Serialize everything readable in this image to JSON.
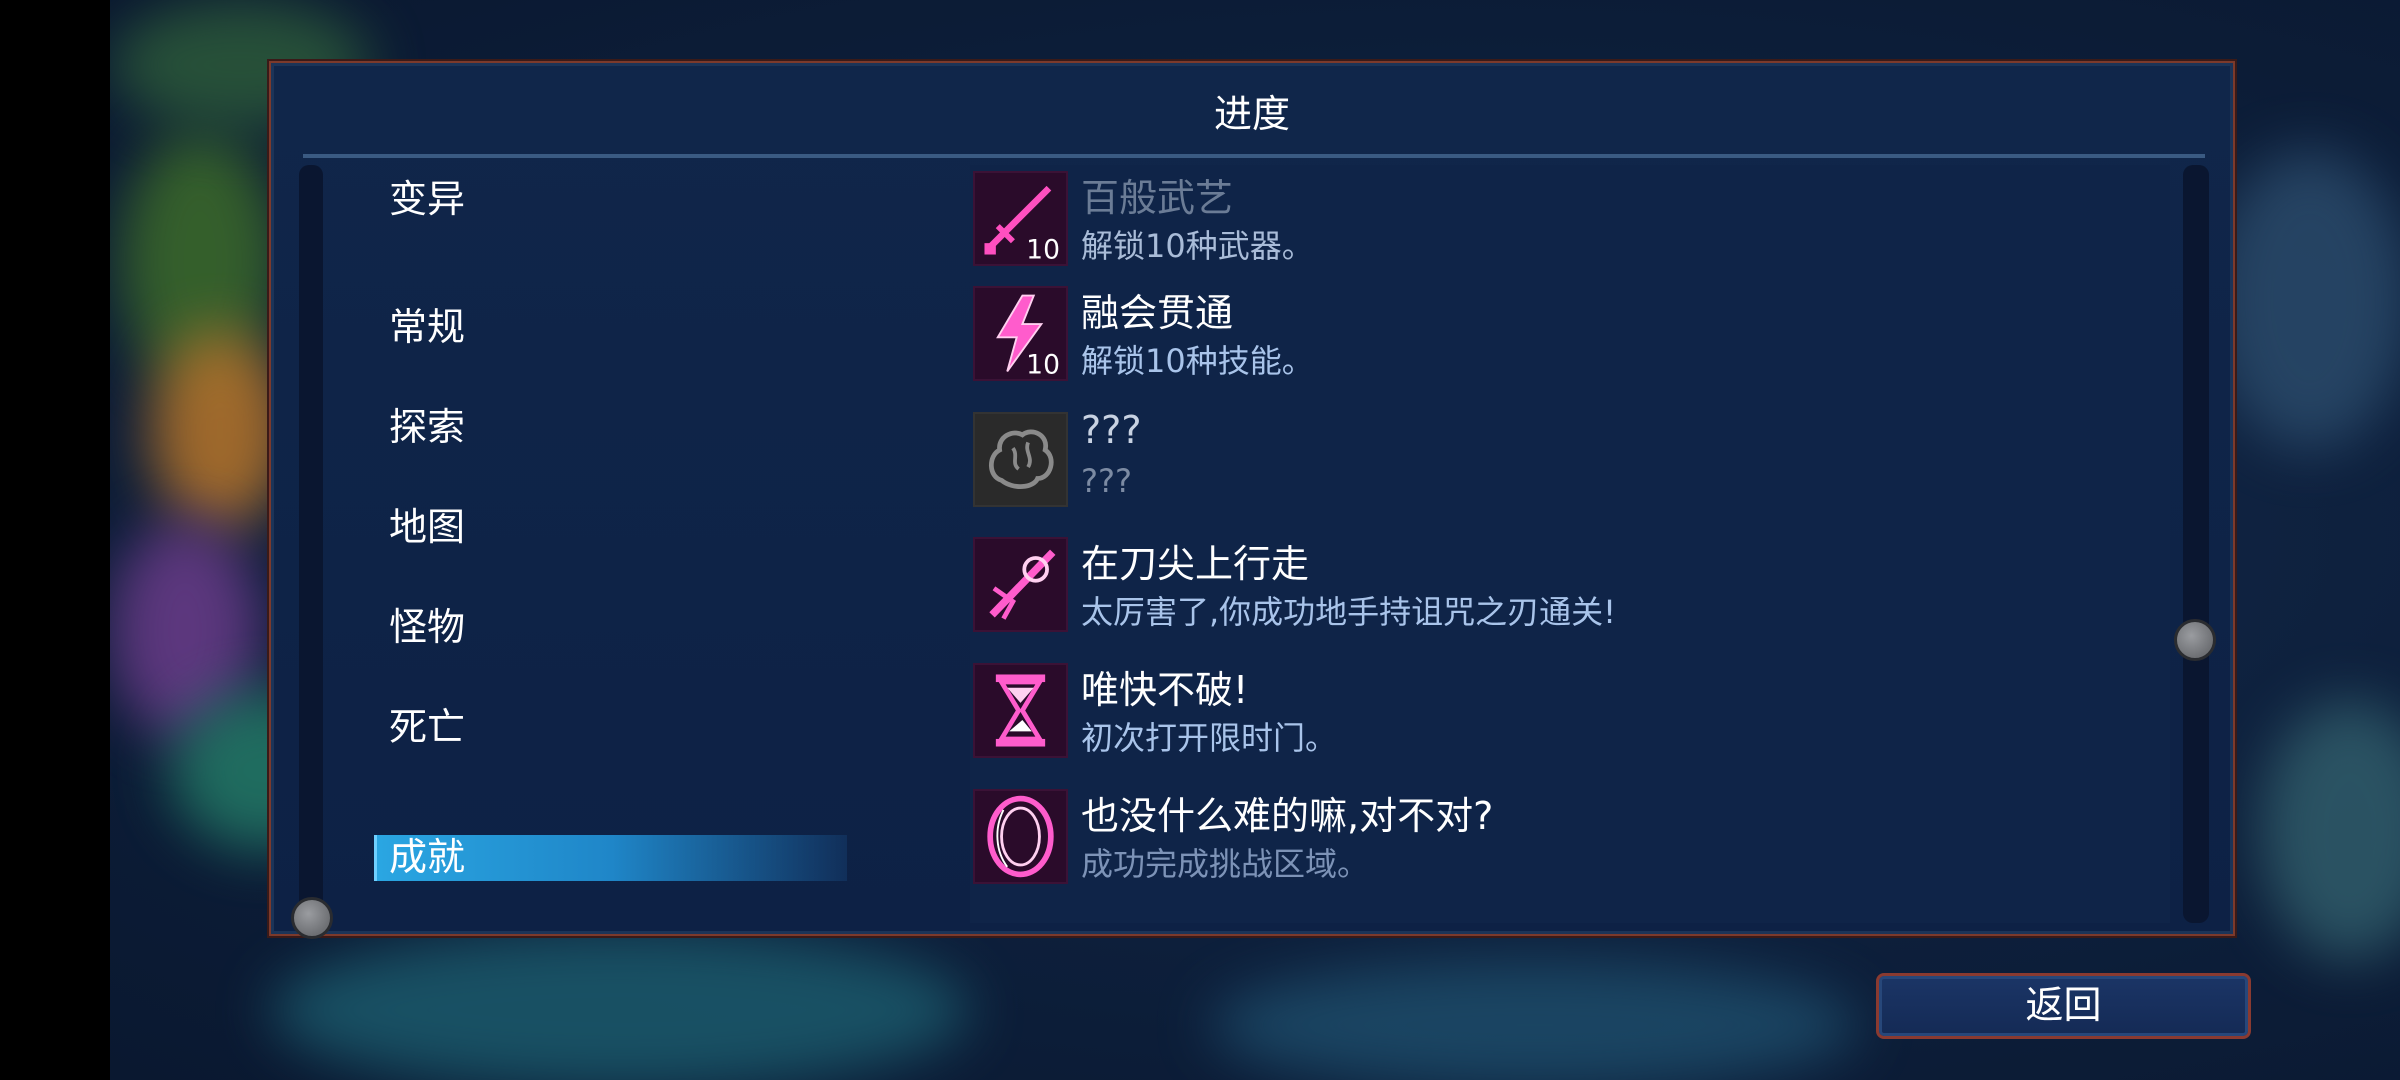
{
  "panel": {
    "title": "进度"
  },
  "categories": [
    {
      "label": "变异"
    },
    {
      "label": "常规"
    },
    {
      "label": "探索"
    },
    {
      "label": "地图"
    },
    {
      "label": "怪物"
    },
    {
      "label": "死亡"
    },
    {
      "label": "成就",
      "selected": true
    }
  ],
  "achievements": [
    {
      "title": "百般武艺",
      "desc": "解锁10种武器。",
      "icon": "sword-10-icon",
      "badge": "10"
    },
    {
      "title": "融会贯通",
      "desc": "解锁10种技能。",
      "icon": "lightning-10-icon",
      "badge": "10"
    },
    {
      "title": "???",
      "desc": "???",
      "icon": "locked-brain-icon"
    },
    {
      "title": "在刀尖上行走",
      "desc": "太厉害了,你成功地手持诅咒之刃通关!",
      "icon": "cursed-blade-icon"
    },
    {
      "title": "唯快不破!",
      "desc": "初次打开限时门。",
      "icon": "hourglass-icon"
    },
    {
      "title": "也没什么难的嘛,对不对?",
      "desc": "成功完成挑战区域。",
      "icon": "portal-ring-icon"
    }
  ],
  "footer": {
    "back_label": "返回"
  },
  "colors": {
    "accent_magenta": "#ff2fa8",
    "selected_blue": "#2aa6e2",
    "panel_border": "#7c3a2c"
  }
}
